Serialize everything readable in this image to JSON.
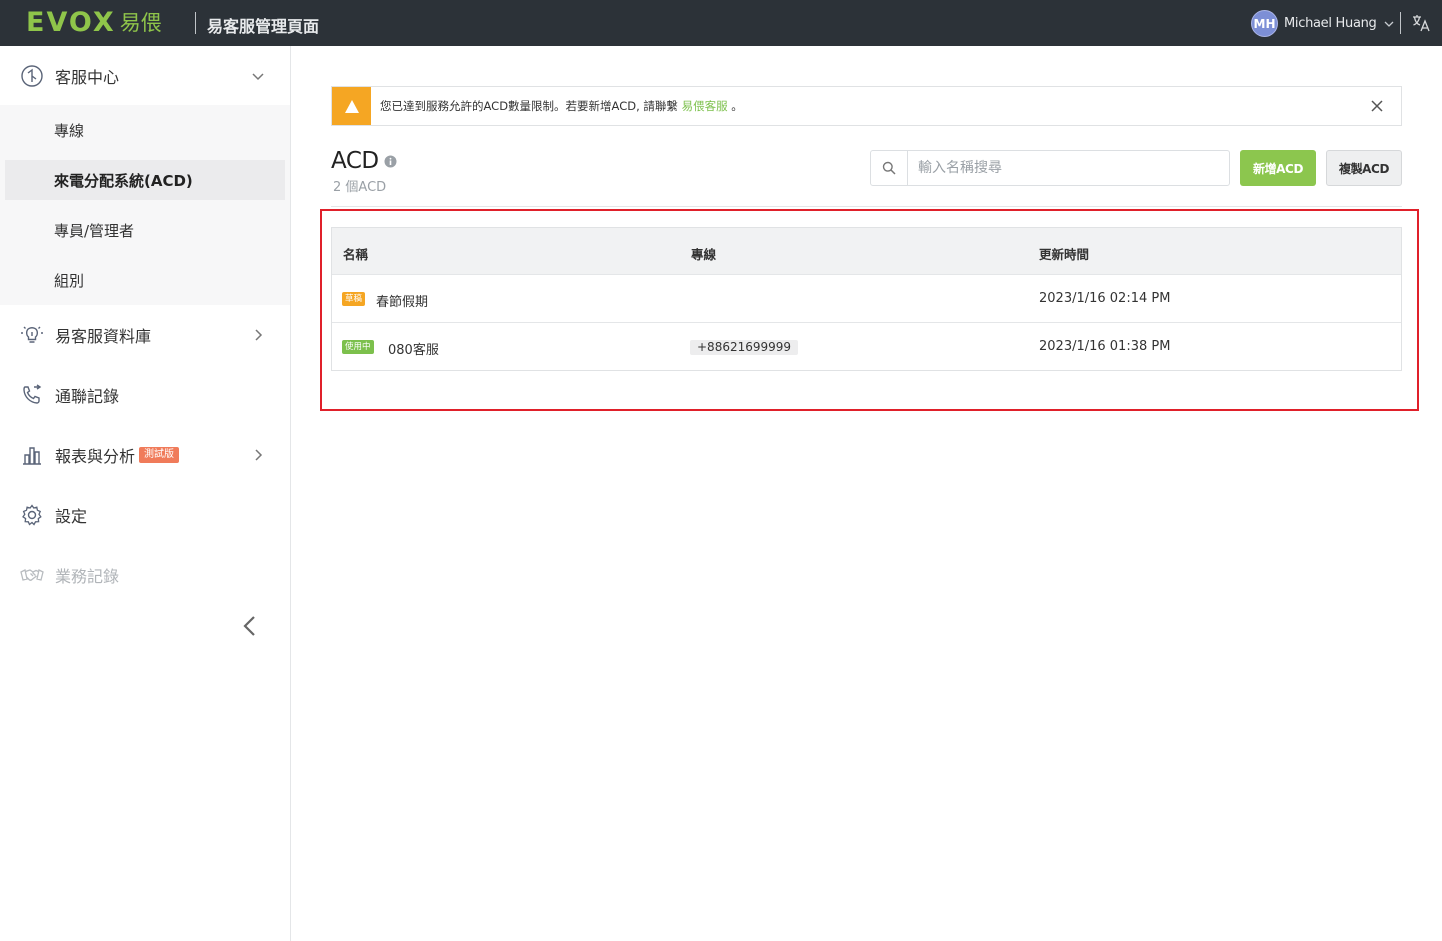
{
  "header": {
    "logo_text": "EVOX",
    "logo_cn": "易偎",
    "title": "易客服管理頁面",
    "user_initials": "MH",
    "user_name": "Michael Huang"
  },
  "sidebar": {
    "items": [
      {
        "label": "客服中心",
        "icon": "service-center-icon"
      },
      {
        "label": "易客服資料庫",
        "icon": "bulb-icon"
      },
      {
        "label": "通聯記錄",
        "icon": "phone-log-icon"
      },
      {
        "label": "報表與分析",
        "icon": "chart-icon",
        "badge": "測試版"
      },
      {
        "label": "設定",
        "icon": "gear-icon"
      },
      {
        "label": "業務記錄",
        "icon": "handshake-icon"
      }
    ],
    "sub_items": [
      {
        "label": "專線"
      },
      {
        "label": "來電分配系統(ACD)"
      },
      {
        "label": "專員/管理者"
      },
      {
        "label": "組別"
      }
    ]
  },
  "alert": {
    "text": "您已達到服務允許的ACD數量限制。若要新增ACD, 請聯繫",
    "link_text": "易偎客服",
    "suffix": "。"
  },
  "page": {
    "title": "ACD",
    "count": "2 個ACD"
  },
  "search": {
    "placeholder": "輸入名稱搜尋"
  },
  "buttons": {
    "add": "新增ACD",
    "copy": "複製ACD"
  },
  "table": {
    "columns": [
      "名稱",
      "專線",
      "更新時間"
    ],
    "rows": [
      {
        "status": "草稿",
        "name": "春節假期",
        "line": "",
        "updated": "2023/1/16 02:14 PM"
      },
      {
        "status": "使用中",
        "name": "080客服",
        "line": "+88621699999",
        "updated": "2023/1/16 01:38 PM"
      }
    ]
  },
  "colors": {
    "topbar": "#2c3238",
    "brand_green": "#8cc64e",
    "warning": "#f5a623",
    "highlight": "#e0202a"
  }
}
